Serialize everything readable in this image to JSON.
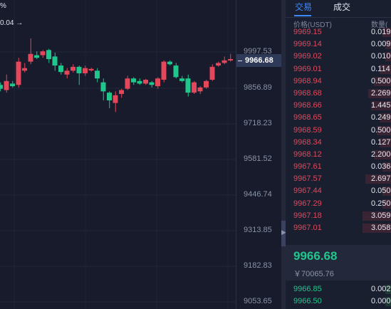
{
  "chart": {
    "percent_label": "%",
    "last_close_label": "0.04 →",
    "current_price": "9966.68",
    "axis_ticks": [
      "9997.53",
      "9856.89",
      "9718.23",
      "9581.52",
      "9446.74",
      "9313.85",
      "9182.83",
      "9053.65"
    ],
    "colors": {
      "up": "#e2475a",
      "down": "#1fc78d"
    },
    "candles": [
      {
        "o": 9870,
        "c": 9855,
        "h": 9880,
        "l": 9845,
        "up": false
      },
      {
        "o": 9850,
        "c": 9885,
        "h": 9910,
        "l": 9840,
        "up": true
      },
      {
        "o": 9875,
        "c": 9865,
        "h": 9885,
        "l": 9860,
        "up": false
      },
      {
        "o": 9870,
        "c": 9960,
        "h": 9975,
        "l": 9860,
        "up": true
      },
      {
        "o": 9925,
        "c": 9935,
        "h": 9955,
        "l": 9918,
        "up": true
      },
      {
        "o": 9960,
        "c": 9990,
        "h": 10050,
        "l": 9950,
        "up": true
      },
      {
        "o": 9985,
        "c": 9975,
        "h": 10000,
        "l": 9970,
        "up": false
      },
      {
        "o": 9985,
        "c": 10000,
        "h": 10005,
        "l": 9975,
        "up": true
      },
      {
        "o": 10005,
        "c": 9970,
        "h": 10010,
        "l": 9955,
        "up": false
      },
      {
        "o": 9980,
        "c": 9945,
        "h": 9995,
        "l": 9925,
        "up": false
      },
      {
        "o": 9945,
        "c": 9920,
        "h": 9955,
        "l": 9910,
        "up": false
      },
      {
        "o": 9910,
        "c": 9925,
        "h": 9935,
        "l": 9895,
        "up": true
      },
      {
        "o": 9925,
        "c": 9940,
        "h": 9950,
        "l": 9918,
        "up": true
      },
      {
        "o": 9940,
        "c": 9915,
        "h": 9945,
        "l": 9870,
        "up": false
      },
      {
        "o": 9915,
        "c": 9935,
        "h": 9945,
        "l": 9905,
        "up": true
      },
      {
        "o": 9932,
        "c": 9926,
        "h": 9936,
        "l": 9922,
        "up": true
      },
      {
        "o": 9925,
        "c": 9895,
        "h": 9935,
        "l": 9880,
        "up": false
      },
      {
        "o": 9880,
        "c": 9845,
        "h": 9895,
        "l": 9810,
        "up": false
      },
      {
        "o": 9840,
        "c": 9810,
        "h": 9845,
        "l": 9780,
        "up": false
      },
      {
        "o": 9800,
        "c": 9830,
        "h": 9845,
        "l": 9765,
        "up": true
      },
      {
        "o": 9835,
        "c": 9850,
        "h": 9855,
        "l": 9820,
        "up": true
      },
      {
        "o": 9855,
        "c": 9895,
        "h": 9905,
        "l": 9850,
        "up": true
      },
      {
        "o": 9895,
        "c": 9880,
        "h": 9900,
        "l": 9870,
        "up": false
      },
      {
        "o": 9885,
        "c": 9875,
        "h": 9895,
        "l": 9870,
        "up": false
      },
      {
        "o": 9875,
        "c": 9890,
        "h": 9893,
        "l": 9870,
        "up": true
      },
      {
        "o": 9880,
        "c": 9870,
        "h": 9885,
        "l": 9860,
        "up": false
      },
      {
        "o": 9865,
        "c": 9895,
        "h": 9900,
        "l": 9855,
        "up": true
      },
      {
        "o": 9890,
        "c": 9960,
        "h": 9965,
        "l": 9880,
        "up": true
      },
      {
        "o": 9960,
        "c": 9950,
        "h": 9965,
        "l": 9945,
        "up": false
      },
      {
        "o": 9945,
        "c": 9900,
        "h": 9955,
        "l": 9895,
        "up": false
      },
      {
        "o": 9895,
        "c": 9885,
        "h": 9905,
        "l": 9880,
        "up": false
      },
      {
        "o": 9895,
        "c": 9840,
        "h": 9910,
        "l": 9825,
        "up": false
      },
      {
        "o": 9840,
        "c": 9880,
        "h": 9885,
        "l": 9835,
        "up": true
      },
      {
        "o": 9845,
        "c": 9860,
        "h": 9865,
        "l": 9835,
        "up": true
      },
      {
        "o": 9860,
        "c": 9885,
        "h": 9890,
        "l": 9855,
        "up": true
      },
      {
        "o": 9890,
        "c": 9940,
        "h": 9950,
        "l": 9885,
        "up": true
      },
      {
        "o": 9955,
        "c": 9945,
        "h": 9960,
        "l": 9940,
        "up": true
      },
      {
        "o": 9955,
        "c": 9965,
        "h": 9980,
        "l": 9950,
        "up": true
      },
      {
        "o": 9965,
        "c": 9970,
        "h": 9990,
        "l": 9960,
        "up": true
      }
    ]
  },
  "tabs": [
    {
      "label": "交易"
    },
    {
      "label": "成交"
    }
  ],
  "orderbook": {
    "header": {
      "price": "价格(USDT)",
      "qty": "数量("
    },
    "asks": [
      {
        "price": "9969.15",
        "qty": "0.019",
        "depth": 0.3
      },
      {
        "price": "9969.14",
        "qty": "0.009",
        "depth": 0.2
      },
      {
        "price": "9969.02",
        "qty": "0.010",
        "depth": 0.2
      },
      {
        "price": "9969.01",
        "qty": "0.114",
        "depth": 0.4
      },
      {
        "price": "9968.94",
        "qty": "0.500",
        "depth": 0.6
      },
      {
        "price": "9968.68",
        "qty": "2.269",
        "depth": 0.8
      },
      {
        "price": "9968.66",
        "qty": "1.445",
        "depth": 0.7
      },
      {
        "price": "9968.65",
        "qty": "0.249",
        "depth": 0.4
      },
      {
        "price": "9968.59",
        "qty": "0.500",
        "depth": 0.5
      },
      {
        "price": "9968.34",
        "qty": "0.127",
        "depth": 0.4
      },
      {
        "price": "9968.12",
        "qty": "2.200",
        "depth": 0.6
      },
      {
        "price": "9967.61",
        "qty": "0.036",
        "depth": 0.3
      },
      {
        "price": "9967.57",
        "qty": "2.697",
        "depth": 0.9
      },
      {
        "price": "9967.44",
        "qty": "0.050",
        "depth": 0.3
      },
      {
        "price": "9967.29",
        "qty": "0.250",
        "depth": 0.3
      },
      {
        "price": "9967.18",
        "qty": "3.059",
        "depth": 1.0
      },
      {
        "price": "9967.01",
        "qty": "3.058",
        "depth": 1.0
      }
    ],
    "last_price": "9966.68",
    "last_price_cny": "￥70065.76",
    "bids": [
      {
        "price": "9966.85",
        "qty": "0.002",
        "depth": 0.2
      },
      {
        "price": "9966.50",
        "qty": "0.000",
        "depth": 0.2
      }
    ]
  }
}
